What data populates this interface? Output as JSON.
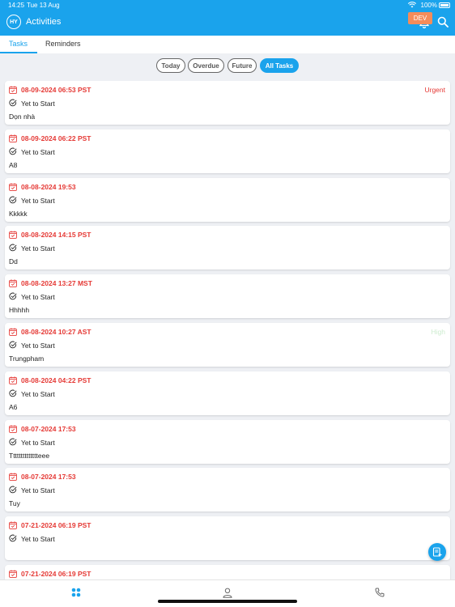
{
  "status_bar": {
    "time": "14:25",
    "date": "Tue 13 Aug",
    "battery": "100%"
  },
  "header": {
    "avatar": "HY",
    "title": "Activities",
    "env_badge": "DEV",
    "icons": [
      "bell-icon",
      "search-icon"
    ]
  },
  "tabs": [
    {
      "label": "Tasks",
      "active": true
    },
    {
      "label": "Reminders",
      "active": false
    }
  ],
  "filters": [
    {
      "label": "Today",
      "active": false
    },
    {
      "label": "Overdue",
      "active": false
    },
    {
      "label": "Future",
      "active": false
    },
    {
      "label": "All Tasks",
      "active": true
    }
  ],
  "tasks": [
    {
      "date": "08-09-2024 06:53 PST",
      "status": "Yet to Start",
      "title": "Dọn nhà",
      "priority": "Urgent"
    },
    {
      "date": "08-09-2024 06:22 PST",
      "status": "Yet to Start",
      "title": "A8",
      "priority": ""
    },
    {
      "date": "08-08-2024 19:53",
      "status": "Yet to Start",
      "title": "Kkkkk",
      "priority": ""
    },
    {
      "date": "08-08-2024 14:15 PST",
      "status": "Yet to Start",
      "title": "Dd",
      "priority": ""
    },
    {
      "date": "08-08-2024 13:27 MST",
      "status": "Yet to Start",
      "title": "Hhhhh",
      "priority": ""
    },
    {
      "date": "08-08-2024 10:27 AST",
      "status": "Yet to Start",
      "title": "Trungpham",
      "priority": "High"
    },
    {
      "date": "08-08-2024 04:22 PST",
      "status": "Yet to Start",
      "title": "A6",
      "priority": ""
    },
    {
      "date": "08-07-2024 17:53",
      "status": "Yet to Start",
      "title": "Tttttttttttttteee",
      "priority": ""
    },
    {
      "date": "08-07-2024 17:53",
      "status": "Yet to Start",
      "title": "Tuy",
      "priority": ""
    },
    {
      "date": "07-21-2024 06:19 PST",
      "status": "Yet to Start",
      "title": "",
      "priority": ""
    },
    {
      "date": "07-21-2024 06:19 PST",
      "status": "Yet to Start",
      "title": "",
      "priority": ""
    }
  ],
  "colors": {
    "primary": "#1aa3ec",
    "overdue_date": "#e53935",
    "dev_badge": "#f48c5a"
  },
  "bottom_nav": [
    "grid-icon",
    "person-icon",
    "phone-icon"
  ]
}
